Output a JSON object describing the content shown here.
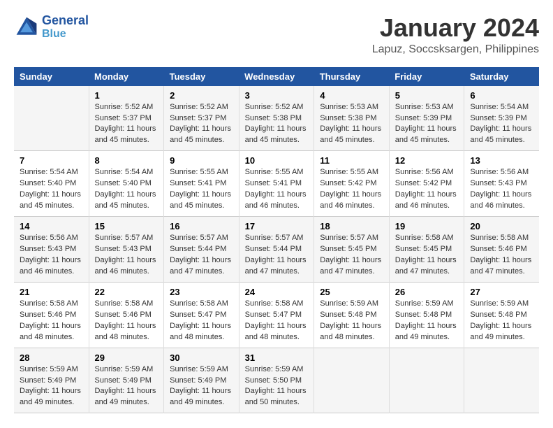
{
  "logo": {
    "line1": "General",
    "line2": "Blue"
  },
  "title": "January 2024",
  "subtitle": "Lapuz, Soccsksargen, Philippines",
  "headers": [
    "Sunday",
    "Monday",
    "Tuesday",
    "Wednesday",
    "Thursday",
    "Friday",
    "Saturday"
  ],
  "weeks": [
    [
      {
        "day": "",
        "info": ""
      },
      {
        "day": "1",
        "info": "Sunrise: 5:52 AM\nSunset: 5:37 PM\nDaylight: 11 hours\nand 45 minutes."
      },
      {
        "day": "2",
        "info": "Sunrise: 5:52 AM\nSunset: 5:37 PM\nDaylight: 11 hours\nand 45 minutes."
      },
      {
        "day": "3",
        "info": "Sunrise: 5:52 AM\nSunset: 5:38 PM\nDaylight: 11 hours\nand 45 minutes."
      },
      {
        "day": "4",
        "info": "Sunrise: 5:53 AM\nSunset: 5:38 PM\nDaylight: 11 hours\nand 45 minutes."
      },
      {
        "day": "5",
        "info": "Sunrise: 5:53 AM\nSunset: 5:39 PM\nDaylight: 11 hours\nand 45 minutes."
      },
      {
        "day": "6",
        "info": "Sunrise: 5:54 AM\nSunset: 5:39 PM\nDaylight: 11 hours\nand 45 minutes."
      }
    ],
    [
      {
        "day": "7",
        "info": "Sunrise: 5:54 AM\nSunset: 5:40 PM\nDaylight: 11 hours\nand 45 minutes."
      },
      {
        "day": "8",
        "info": "Sunrise: 5:54 AM\nSunset: 5:40 PM\nDaylight: 11 hours\nand 45 minutes."
      },
      {
        "day": "9",
        "info": "Sunrise: 5:55 AM\nSunset: 5:41 PM\nDaylight: 11 hours\nand 45 minutes."
      },
      {
        "day": "10",
        "info": "Sunrise: 5:55 AM\nSunset: 5:41 PM\nDaylight: 11 hours\nand 46 minutes."
      },
      {
        "day": "11",
        "info": "Sunrise: 5:55 AM\nSunset: 5:42 PM\nDaylight: 11 hours\nand 46 minutes."
      },
      {
        "day": "12",
        "info": "Sunrise: 5:56 AM\nSunset: 5:42 PM\nDaylight: 11 hours\nand 46 minutes."
      },
      {
        "day": "13",
        "info": "Sunrise: 5:56 AM\nSunset: 5:43 PM\nDaylight: 11 hours\nand 46 minutes."
      }
    ],
    [
      {
        "day": "14",
        "info": "Sunrise: 5:56 AM\nSunset: 5:43 PM\nDaylight: 11 hours\nand 46 minutes."
      },
      {
        "day": "15",
        "info": "Sunrise: 5:57 AM\nSunset: 5:43 PM\nDaylight: 11 hours\nand 46 minutes."
      },
      {
        "day": "16",
        "info": "Sunrise: 5:57 AM\nSunset: 5:44 PM\nDaylight: 11 hours\nand 47 minutes."
      },
      {
        "day": "17",
        "info": "Sunrise: 5:57 AM\nSunset: 5:44 PM\nDaylight: 11 hours\nand 47 minutes."
      },
      {
        "day": "18",
        "info": "Sunrise: 5:57 AM\nSunset: 5:45 PM\nDaylight: 11 hours\nand 47 minutes."
      },
      {
        "day": "19",
        "info": "Sunrise: 5:58 AM\nSunset: 5:45 PM\nDaylight: 11 hours\nand 47 minutes."
      },
      {
        "day": "20",
        "info": "Sunrise: 5:58 AM\nSunset: 5:46 PM\nDaylight: 11 hours\nand 47 minutes."
      }
    ],
    [
      {
        "day": "21",
        "info": "Sunrise: 5:58 AM\nSunset: 5:46 PM\nDaylight: 11 hours\nand 48 minutes."
      },
      {
        "day": "22",
        "info": "Sunrise: 5:58 AM\nSunset: 5:46 PM\nDaylight: 11 hours\nand 48 minutes."
      },
      {
        "day": "23",
        "info": "Sunrise: 5:58 AM\nSunset: 5:47 PM\nDaylight: 11 hours\nand 48 minutes."
      },
      {
        "day": "24",
        "info": "Sunrise: 5:58 AM\nSunset: 5:47 PM\nDaylight: 11 hours\nand 48 minutes."
      },
      {
        "day": "25",
        "info": "Sunrise: 5:59 AM\nSunset: 5:48 PM\nDaylight: 11 hours\nand 48 minutes."
      },
      {
        "day": "26",
        "info": "Sunrise: 5:59 AM\nSunset: 5:48 PM\nDaylight: 11 hours\nand 49 minutes."
      },
      {
        "day": "27",
        "info": "Sunrise: 5:59 AM\nSunset: 5:48 PM\nDaylight: 11 hours\nand 49 minutes."
      }
    ],
    [
      {
        "day": "28",
        "info": "Sunrise: 5:59 AM\nSunset: 5:49 PM\nDaylight: 11 hours\nand 49 minutes."
      },
      {
        "day": "29",
        "info": "Sunrise: 5:59 AM\nSunset: 5:49 PM\nDaylight: 11 hours\nand 49 minutes."
      },
      {
        "day": "30",
        "info": "Sunrise: 5:59 AM\nSunset: 5:49 PM\nDaylight: 11 hours\nand 49 minutes."
      },
      {
        "day": "31",
        "info": "Sunrise: 5:59 AM\nSunset: 5:50 PM\nDaylight: 11 hours\nand 50 minutes."
      },
      {
        "day": "",
        "info": ""
      },
      {
        "day": "",
        "info": ""
      },
      {
        "day": "",
        "info": ""
      }
    ]
  ]
}
